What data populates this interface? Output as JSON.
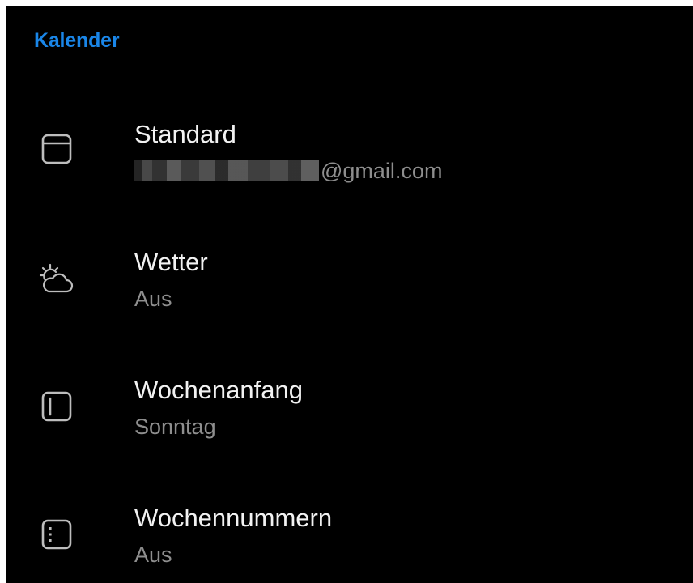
{
  "section": {
    "title": "Kalender"
  },
  "settings": [
    {
      "title": "Standard",
      "subtitle_suffix": "@gmail.com",
      "subtitle_masked": true,
      "icon": "calendar-icon"
    },
    {
      "title": "Wetter",
      "subtitle": "Aus",
      "icon": "weather-icon"
    },
    {
      "title": "Wochenanfang",
      "subtitle": "Sonntag",
      "icon": "week-start-icon"
    },
    {
      "title": "Wochennummern",
      "subtitle": "Aus",
      "icon": "week-numbers-icon"
    }
  ],
  "colors": {
    "background": "#000000",
    "accent": "#1a86e8",
    "title_text": "#f2f2f2",
    "subtitle_text": "#8e8e8e"
  }
}
